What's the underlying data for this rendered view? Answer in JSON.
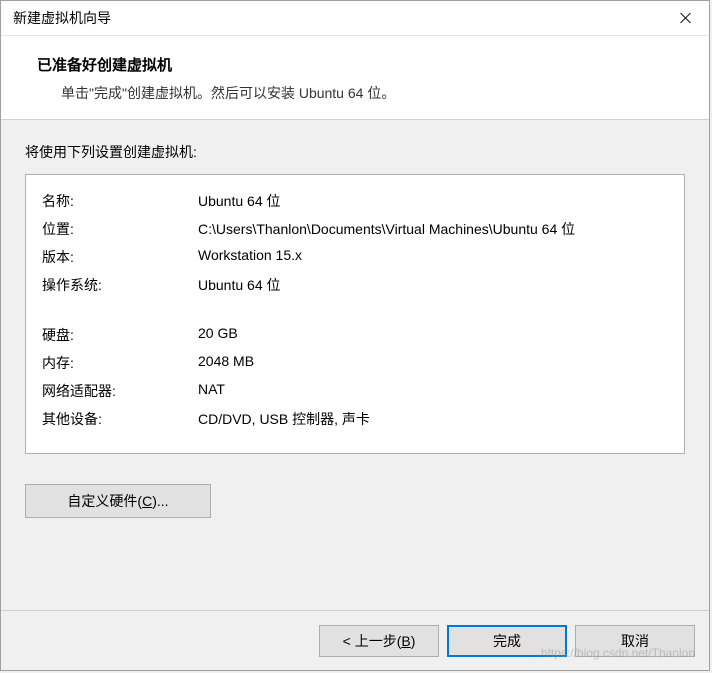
{
  "window": {
    "title": "新建虚拟机向导"
  },
  "header": {
    "title": "已准备好创建虚拟机",
    "subtitle": "单击\"完成\"创建虚拟机。然后可以安装 Ubuntu 64 位。"
  },
  "content": {
    "intro": "将使用下列设置创建虚拟机:"
  },
  "settings": {
    "name_label": "名称:",
    "name_value": "Ubuntu 64 位",
    "location_label": "位置:",
    "location_value": "C:\\Users\\Thanlon\\Documents\\Virtual Machines\\Ubuntu 64 位",
    "version_label": "版本:",
    "version_value": "Workstation 15.x",
    "os_label": "操作系统:",
    "os_value": "Ubuntu 64 位",
    "disk_label": "硬盘:",
    "disk_value": "20 GB",
    "memory_label": "内存:",
    "memory_value": "2048 MB",
    "network_label": "网络适配器:",
    "network_value": "NAT",
    "other_label": "其他设备:",
    "other_value": "CD/DVD, USB 控制器, 声卡"
  },
  "buttons": {
    "customize_prefix": "自定义硬件(",
    "customize_key": "C",
    "customize_suffix": ")...",
    "back_prefix": "< 上一步(",
    "back_key": "B",
    "back_suffix": ")",
    "finish": "完成",
    "cancel": "取消"
  },
  "watermark": "https://blog.csdn.net/Thanlon"
}
